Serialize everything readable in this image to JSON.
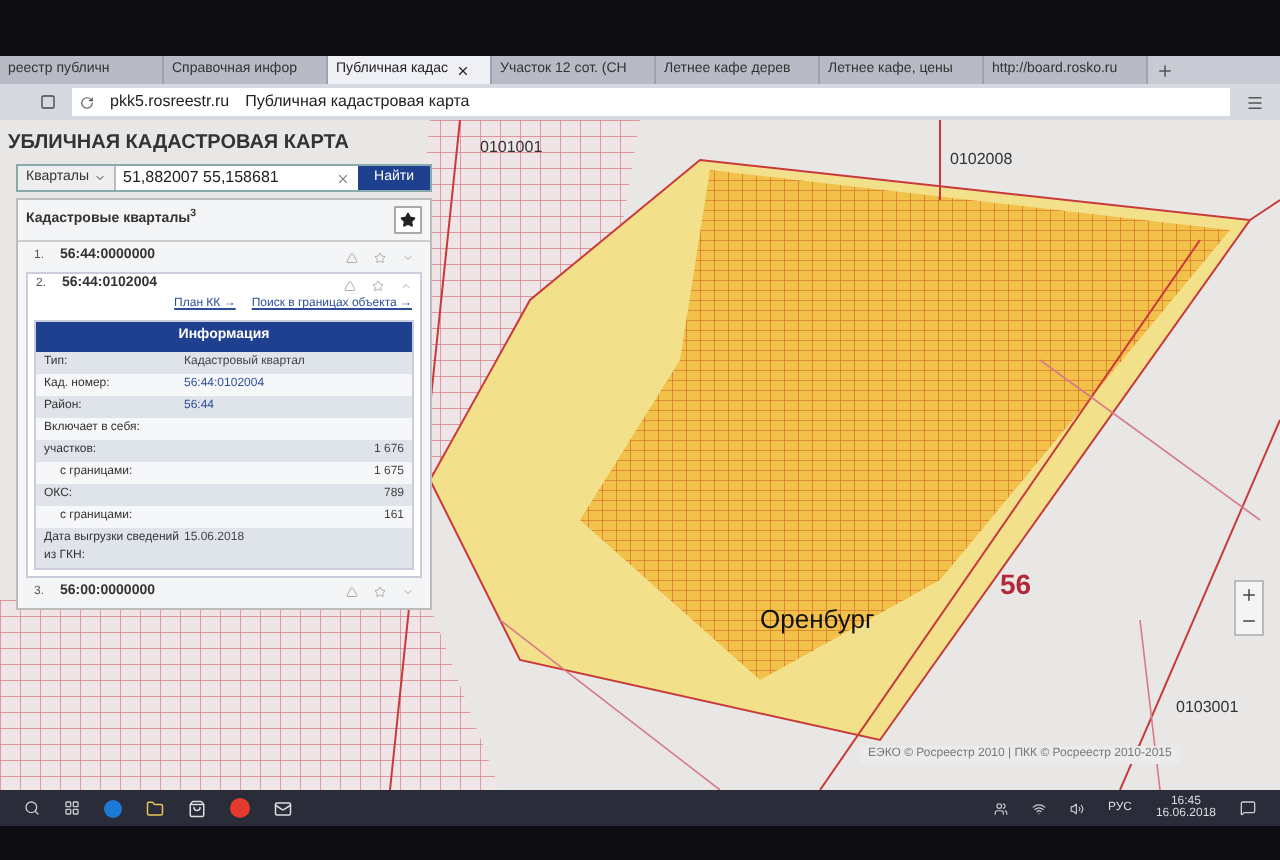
{
  "browser": {
    "tabs": [
      {
        "label": "реестр публичн",
        "selected": false
      },
      {
        "label": "Справочная инфор",
        "selected": false
      },
      {
        "label": "Публичная кадас",
        "selected": true
      },
      {
        "label": "Участок 12 сот. (СН",
        "selected": false
      },
      {
        "label": "Летнее кафе дерев",
        "selected": false
      },
      {
        "label": "Летнее кафе, цены",
        "selected": false
      },
      {
        "label": "http://board.rosko.ru",
        "selected": false
      }
    ],
    "address": {
      "domain": "pkk5.rosreestr.ru",
      "title": "Публичная кадастровая карта"
    }
  },
  "panel": {
    "title": "УБЛИЧНАЯ КАДАСТРОВАЯ КАРТА",
    "search": {
      "mode": "Кварталы",
      "value": "51,882007 55,158681",
      "button": "Найти"
    },
    "results": {
      "heading": "Кадастровые кварталы",
      "count": "3",
      "items": [
        {
          "number": "1.",
          "code": "56:44:0000000",
          "expanded": false
        },
        {
          "number": "2.",
          "code": "56:44:0102004",
          "expanded": true,
          "links": [
            "План КК →",
            "Поиск в границах объекта →"
          ],
          "info": {
            "title": "Информация",
            "rows": [
              {
                "kind": "plain",
                "label": "Тип:",
                "value": "Кадастровый квартал"
              },
              {
                "kind": "link",
                "label": "Кад. номер:",
                "value": "56:44:0102004"
              },
              {
                "kind": "link",
                "label": "Район:",
                "value": "56:44"
              },
              {
                "kind": "section",
                "label": "Включает в себя:"
              },
              {
                "kind": "count",
                "label": "участков:",
                "value": "1 676"
              },
              {
                "kind": "sub",
                "label": "с границами:",
                "value": "1 675"
              },
              {
                "kind": "count",
                "label": "ОКС:",
                "value": "789"
              },
              {
                "kind": "sub",
                "label": "с границами:",
                "value": "161"
              },
              {
                "kind": "plain",
                "label": "Дата выгрузки сведений из ГКН:",
                "value": "15.06.2018"
              }
            ]
          }
        },
        {
          "number": "3.",
          "code": "56:00:0000000",
          "expanded": false
        }
      ]
    }
  },
  "map": {
    "labels": [
      {
        "kind": "block",
        "text": "0101001"
      },
      {
        "kind": "block",
        "text": "0102008"
      },
      {
        "kind": "city",
        "text": "Оренбург"
      },
      {
        "kind": "region",
        "text": "56"
      },
      {
        "kind": "block",
        "text": "0103001"
      }
    ],
    "attribution": "ЕЭКО © Росреестр 2010 | ПКК © Росреестр 2010-2015"
  },
  "taskbar": {
    "language": "РУС",
    "time": "16:45",
    "date": "16.06.2018"
  }
}
